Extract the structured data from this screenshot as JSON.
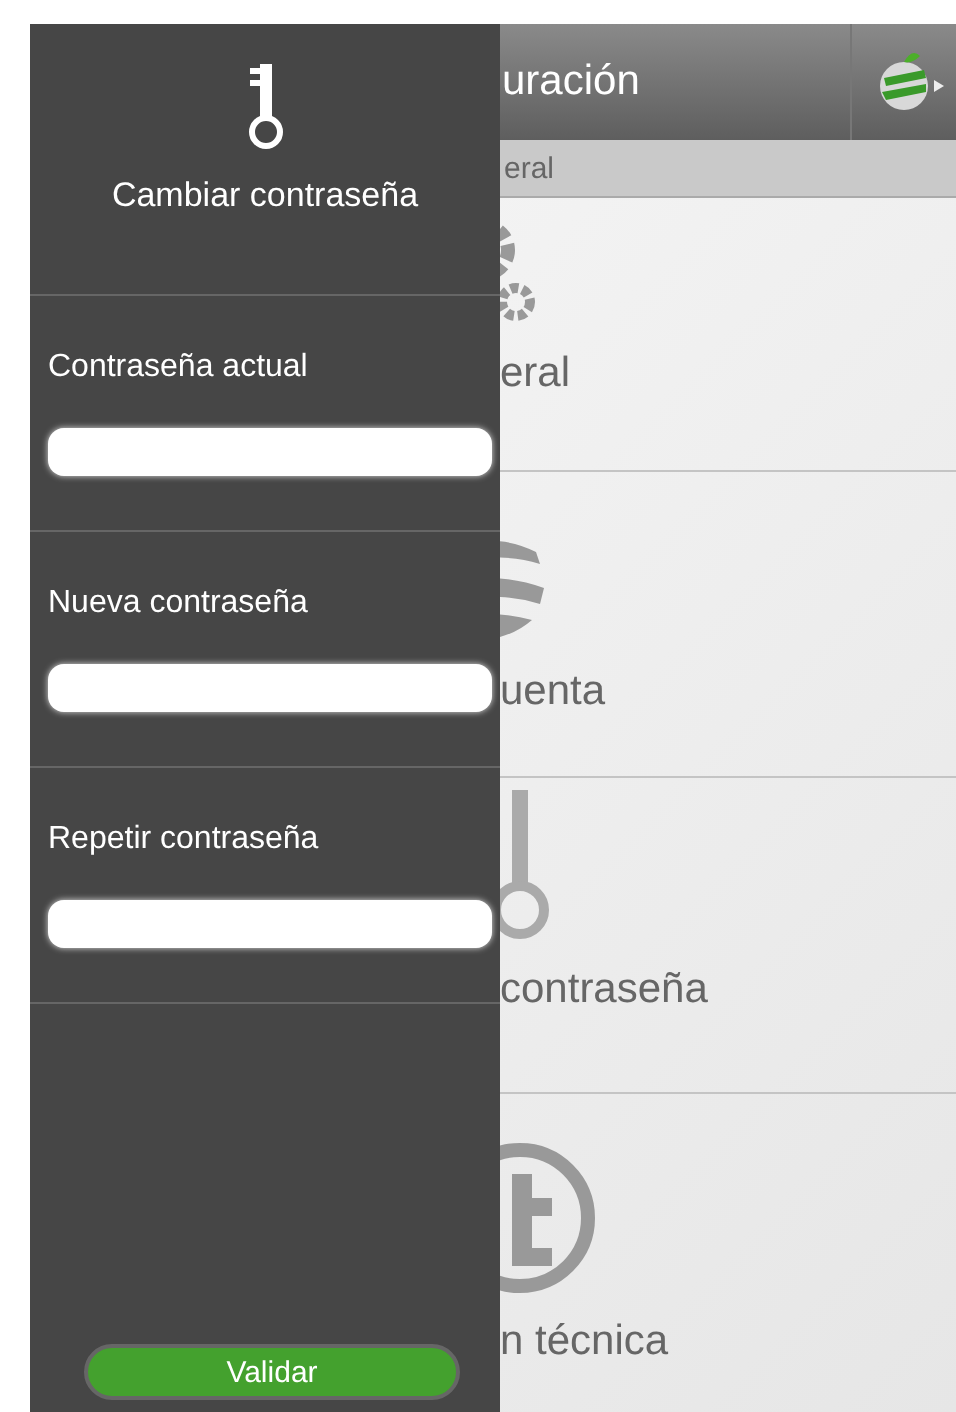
{
  "header": {
    "title_visible": "uración"
  },
  "section": {
    "title_visible": "eral"
  },
  "menu_items": [
    {
      "label_visible": "eral",
      "kind": "gears"
    },
    {
      "label_visible": "uenta",
      "kind": "globe"
    },
    {
      "label_visible": "contraseña",
      "kind": "key"
    },
    {
      "label_visible": "n técnica",
      "kind": "at"
    }
  ],
  "panel": {
    "title": "Cambiar contraseña",
    "fields": [
      {
        "label": "Contraseña actual"
      },
      {
        "label": "Nueva contraseña"
      },
      {
        "label": "Repetir contraseña"
      }
    ],
    "button": "Validar"
  }
}
